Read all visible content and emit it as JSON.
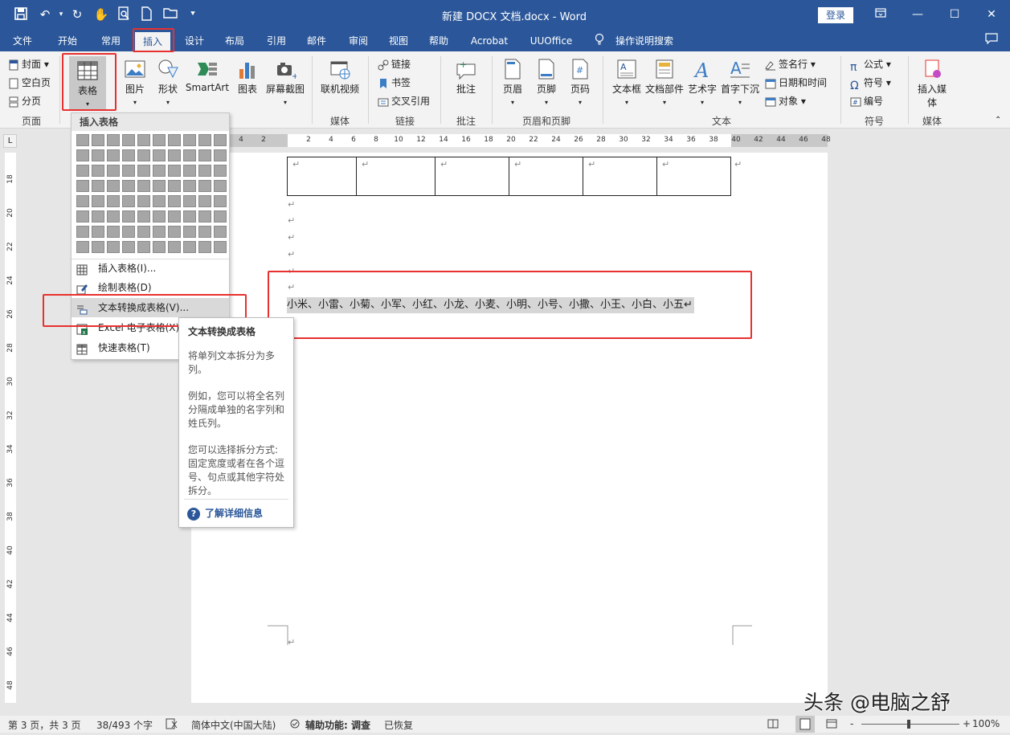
{
  "titlebar": {
    "title": "新建 DOCX 文档.docx  -  Word",
    "login": "登录",
    "quick_icons": [
      "save-icon",
      "undo-icon",
      "redo-icon",
      "touch-mode-icon",
      "print-preview-icon",
      "new-doc-icon",
      "open-icon",
      "customize-icon"
    ],
    "window_buttons": [
      "ribbon-display-icon",
      "minimize-icon",
      "maximize-icon",
      "close-icon"
    ]
  },
  "menu": {
    "items": [
      "文件",
      "开始",
      "常用",
      "插入",
      "设计",
      "布局",
      "引用",
      "邮件",
      "审阅",
      "视图",
      "帮助",
      "Acrobat",
      "UUOffice",
      "操作说明搜索"
    ],
    "active": "插入"
  },
  "ribbon": {
    "pages_group": {
      "cover": "封面",
      "blank": "空白页",
      "break": "分页",
      "label": "页面"
    },
    "table": "表格",
    "picture": "图片",
    "shape": "形状",
    "smartart": "SmartArt",
    "chart": "图表",
    "screenshot": "屏幕截图",
    "media": {
      "online_video": "联机视频",
      "label": "媒体"
    },
    "links": {
      "link": "链接",
      "bookmark": "书签",
      "cross_ref": "交叉引用",
      "label": "链接"
    },
    "comments": {
      "comment": "批注",
      "label": "批注"
    },
    "header_footer": {
      "header": "页眉",
      "footer": "页脚",
      "page_number": "页码",
      "label": "页眉和页脚"
    },
    "text": {
      "textbox": "文本框",
      "quickparts": "文档部件",
      "wordart": "艺术字",
      "dropcap": "首字下沉",
      "signature": "签名行",
      "datetime": "日期和时间",
      "object": "对象",
      "label": "文本"
    },
    "symbols": {
      "equation": "公式",
      "symbol": "符号",
      "numbering": "编号",
      "label": "符号"
    },
    "insert_media": {
      "button": "插入媒体",
      "label": "媒体"
    }
  },
  "ruler": {
    "h_ticks": [
      "4",
      "2",
      "2",
      "4",
      "6",
      "8",
      "10",
      "12",
      "14",
      "16",
      "18",
      "20",
      "22",
      "24",
      "26",
      "28",
      "30",
      "32",
      "34",
      "36",
      "38",
      "40",
      "42",
      "44",
      "46",
      "48"
    ],
    "v_ticks": [
      "18",
      "20",
      "22",
      "24",
      "26",
      "28",
      "30",
      "32",
      "34",
      "36",
      "38",
      "40",
      "42",
      "44",
      "46",
      "48"
    ]
  },
  "document": {
    "selected_text": "小米、小雷、小菊、小军、小红、小龙、小麦、小明、小号、小撒、小王、小白、小五↵",
    "para_mark": "↵"
  },
  "dropdown": {
    "header": "插入表格",
    "items": [
      {
        "label": "插入表格(I)...",
        "icon": "table-grid-icon"
      },
      {
        "label": "绘制表格(D)",
        "icon": "draw-table-icon"
      },
      {
        "label": "文本转换成表格(V)...",
        "icon": "text-to-table-icon"
      },
      {
        "label": "Excel 电子表格(X)",
        "icon": "excel-icon"
      },
      {
        "label": "快速表格(T)",
        "icon": "quick-table-icon"
      }
    ]
  },
  "tooltip": {
    "title": "文本转换成表格",
    "p1": "将单列文本拆分为多列。",
    "p2": "例如，您可以将全名列分隔成单独的名字列和姓氏列。",
    "p3": "您可以选择拆分方式: 固定宽度或者在各个逗号、句点或其他字符处拆分。",
    "link": "了解详细信息"
  },
  "status": {
    "page": "第 3 页，共 3 页",
    "words": "38/493 个字",
    "language": "简体中文(中国大陆)",
    "accessibility": "辅助功能: 调查",
    "recovered": "已恢复",
    "zoom": "100%",
    "minus": "-",
    "plus": "+"
  },
  "watermark": "头条 @电脑之舒",
  "colors": {
    "accent": "#2b579a",
    "highlight_box": "#e8302f",
    "selection": "#d6d6d6"
  }
}
